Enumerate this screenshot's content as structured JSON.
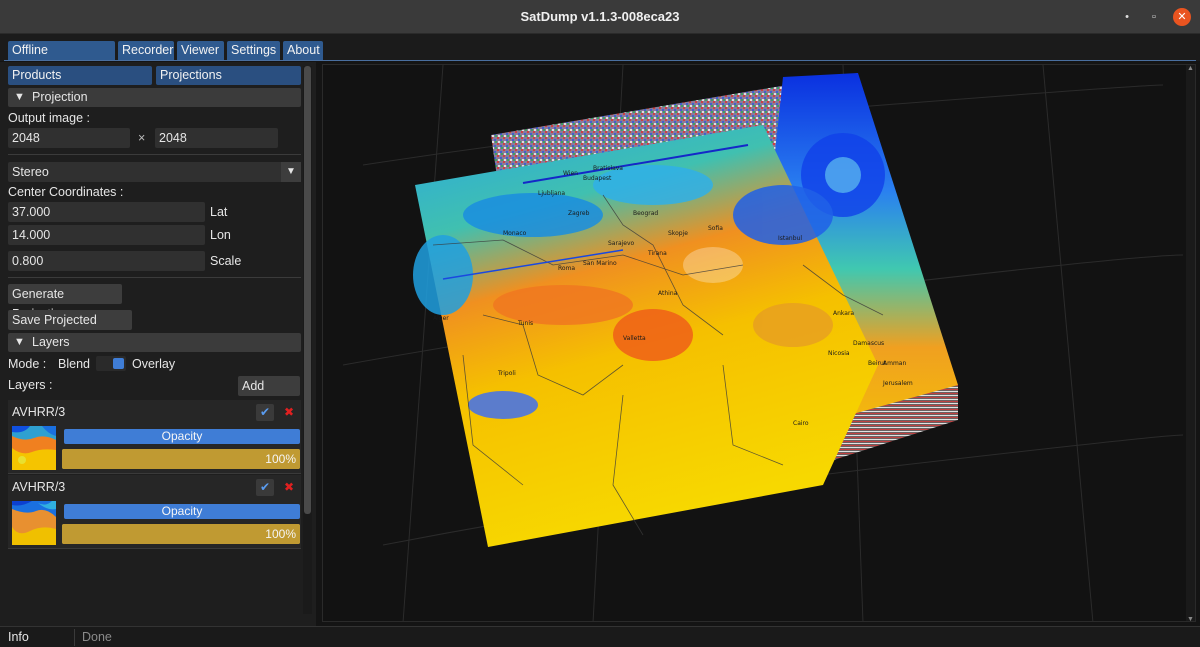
{
  "window": {
    "title": "SatDump v1.1.3-008eca23",
    "minimize_glyph": "•",
    "maximize_glyph": "▫",
    "close_glyph": "✕"
  },
  "tabs": [
    "Offline processing",
    "Recorder",
    "Viewer",
    "Settings",
    "About"
  ],
  "subtabs": [
    "Products",
    "Projections"
  ],
  "projection": {
    "header": "Projection",
    "output_label": "Output image :",
    "width": "2048",
    "times": "×",
    "height": "2048",
    "projection_type": "Stereo",
    "center_label": "Center Coordinates :",
    "lat": "37.000",
    "lat_label": "Lat",
    "lon": "14.000",
    "lon_label": "Lon",
    "scale": "0.800",
    "scale_label": "Scale",
    "generate_button": "Generate Projection",
    "save_button": "Save Projected Image"
  },
  "layers": {
    "header": "Layers",
    "mode_label": "Mode :",
    "mode_blend": "Blend",
    "mode_overlay": "Overlay",
    "layers_label": "Layers :",
    "add_button": "Add Layer",
    "items": [
      {
        "name": "AVHRR/3",
        "opacity_label": "Opacity",
        "opacity": "100%",
        "opacity_value": 1.0
      },
      {
        "name": "AVHRR/3",
        "opacity_label": "Opacity",
        "opacity": "100%",
        "opacity_value": 1.0
      }
    ]
  },
  "status": {
    "label": "Info",
    "message": "Done"
  },
  "map_labels": [
    "Budapest",
    "Beograd",
    "Roma",
    "Tunis",
    "Alger",
    "Athina",
    "Tripoli",
    "Istanbul",
    "Ankara",
    "Damascus",
    "Jerusalem",
    "Cairo",
    "Beirut",
    "Ljubljana",
    "Zagreb",
    "Sarajevo",
    "Tirana",
    "Skopje",
    "Sofia",
    "Valletta",
    "Monaco",
    "San Marino",
    "Amman",
    "Nicosia",
    "Wien",
    "Bratislava"
  ],
  "colors": {
    "accent": "#3f7dd6",
    "tab": "#2f5a8f",
    "slider": "#b3922e",
    "close": "#e95420"
  }
}
